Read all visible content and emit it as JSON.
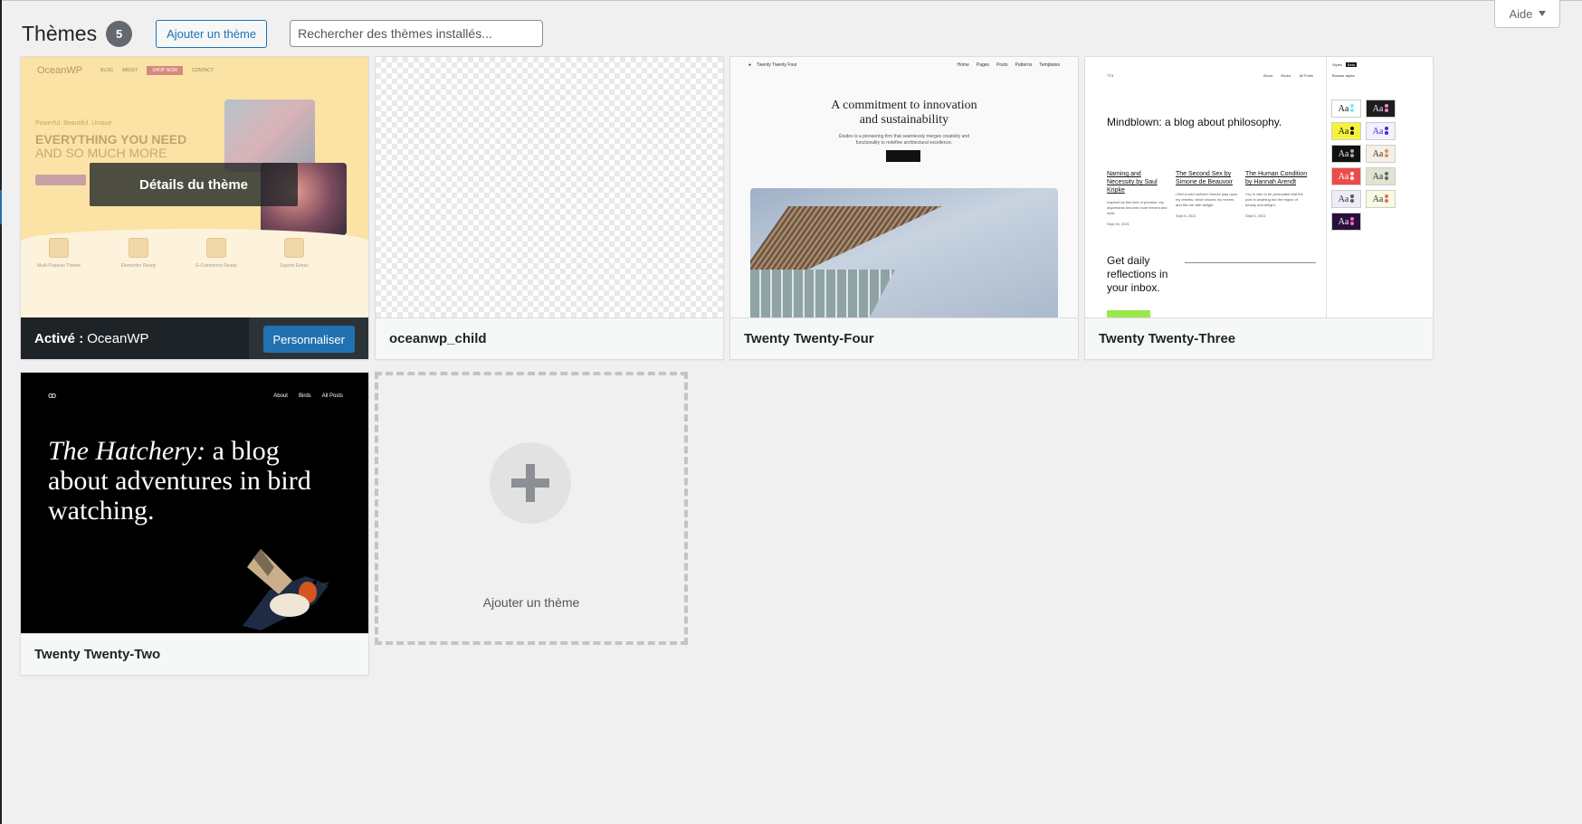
{
  "header": {
    "title": "Thèmes",
    "count": "5",
    "add_button": "Ajouter un thème",
    "search_placeholder": "Rechercher des thèmes installés..."
  },
  "help_tab": {
    "label": "Aide"
  },
  "themes": [
    {
      "name": "OceanWP",
      "active": true,
      "active_prefix": "Activé :",
      "details_overlay": "Détails du thème",
      "customize_button": "Personnaliser",
      "preview": {
        "logo": "OceanWP",
        "nav": [
          "BLOG",
          "ABOUT",
          "SHOP NOW",
          "CONTACT"
        ],
        "tagline": "Powerful. Beautiful. Unique",
        "headline_1": "EVERYTHING YOU NEED",
        "headline_2": "AND SO MUCH MORE",
        "features": [
          "Multi-Purpose Theme",
          "Elementor Ready",
          "E-Commerce Ready",
          "Superb Extras"
        ]
      }
    },
    {
      "name": "oceanwp_child",
      "active": false
    },
    {
      "name": "Twenty Twenty-Four",
      "active": false,
      "preview": {
        "brand": "Twenty Twenty Four",
        "nav": [
          "Home",
          "Pages",
          "Posts",
          "Patterns",
          "Templates"
        ],
        "headline": "A commitment to innovation and sustainability",
        "sub": "Études is a pioneering firm that seamlessly merges creativity and functionality to redefine architectural excellence.",
        "button": "Learn More"
      }
    },
    {
      "name": "Twenty Twenty-Three",
      "active": false,
      "preview": {
        "brand": "TT3",
        "nav": [
          "About",
          "Books",
          "All Posts"
        ],
        "title": "Mindblown: a blog about philosophy.",
        "posts": [
          {
            "title": "Naming and Necessity by Saul Kripke",
            "excerpt": "Inspired by this kind of premise, my daydreams become more fervent and vivid.",
            "date": "Sept 10, 2021"
          },
          {
            "title": "The Second Sex by Simone de Beauvoir",
            "excerpt": "I feel a cold northern breeze play upon my cheeks, which braces my nerves and fills me with delight.",
            "date": "Sept 8, 2021"
          },
          {
            "title": "The Human Condition by Hannah Arendt",
            "excerpt": "I try in vain to be persuaded that the pole is anything but the region of beauty and delight.",
            "date": "Sept 6, 2021"
          }
        ],
        "newsletter": "Get daily reflections in your inbox.",
        "panel_title": "Styles",
        "panel_tag": "Beta",
        "panel_subtitle": "Browse styles",
        "swatch_label": "Aa"
      }
    },
    {
      "name": "Twenty Twenty-Two",
      "active": false,
      "preview": {
        "nav": [
          "About",
          "Birds",
          "All Posts"
        ],
        "headline_italic": "The Hatchery:",
        "headline_rest": "a blog about adventures in bird watching."
      }
    }
  ],
  "add_theme_card": {
    "label": "Ajouter un thème"
  },
  "colors": {
    "background": "#f0f0f1",
    "active_bar": "#1d2327",
    "primary_blue": "#2271b1",
    "badge": "#646970"
  }
}
